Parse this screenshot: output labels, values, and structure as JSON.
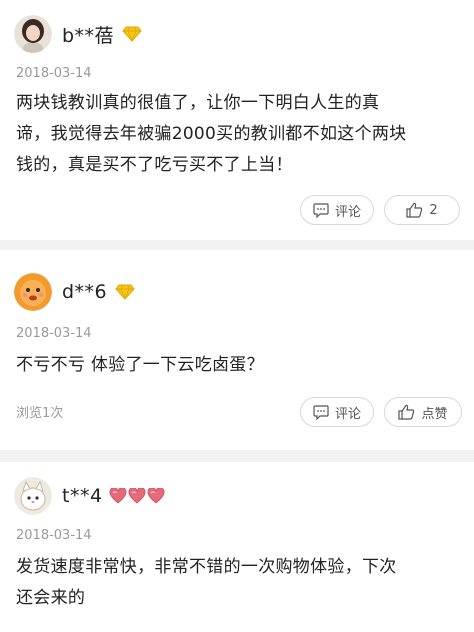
{
  "reviews": [
    {
      "username": "b**蓓",
      "date": "2018-03-14",
      "text_lines": [
        "两块钱教训真的很值了，让你一下明白人生的真",
        "谛，我觉得去年被骗2000买的教训都不如这个两块",
        "钱的，真是买不了吃亏买不了上当！"
      ],
      "comment_label": "评论",
      "like_label": "2",
      "badge": "diamond-vip-icon"
    },
    {
      "username": "d**6",
      "date": "2018-03-14",
      "text_lines": [
        "不亏不亏 体验了一下云吃卤蛋？"
      ],
      "views": "浏览1次",
      "comment_label": "评论",
      "like_label": "点赞",
      "badge": "diamond-vip-icon"
    },
    {
      "username": "t**4",
      "date": "2018-03-14",
      "text_lines": [
        "发货速度非常快，非常不错的一次购物体验，下次",
        "还会来的"
      ],
      "badge": "hearts-level-icon"
    }
  ],
  "colors": {
    "diamond": "#f5c518",
    "heart": "#e56a7a",
    "muted_text": "#9a9a9a",
    "separator": "#f2f2f2"
  }
}
